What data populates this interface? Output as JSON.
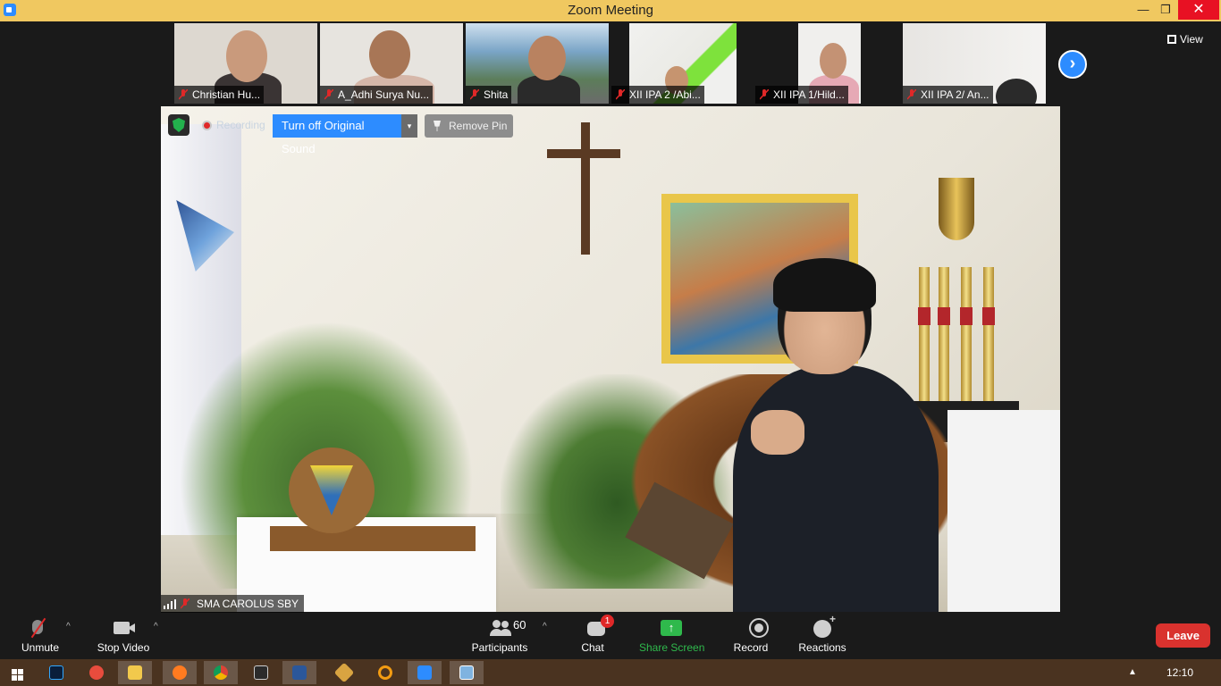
{
  "window": {
    "title": "Zoom Meeting",
    "minimize_glyph": "—",
    "maximize_glyph": "❐",
    "close_glyph": "✕"
  },
  "thumbnails": [
    {
      "name": "Christian Hu..."
    },
    {
      "name": "A_Adhi Surya Nu..."
    },
    {
      "name": "Shita"
    },
    {
      "name": "XII IPA 2 /Abi..."
    },
    {
      "name": "XII IPA 1/Hild..."
    },
    {
      "name": "XII IPA 2/ An..."
    }
  ],
  "view_label": "View",
  "next_glyph": "›",
  "overlay": {
    "recording_label": "Recording",
    "original_sound_label": "Turn off Original Sound",
    "dropdown_glyph": "▾",
    "remove_pin_label": "Remove Pin"
  },
  "main_video": {
    "participant_name": "SMA CAROLUS SBY"
  },
  "toolbar": {
    "unmute_label": "Unmute",
    "stop_video_label": "Stop Video",
    "participants_label": "Participants",
    "participants_count": "60",
    "chat_label": "Chat",
    "chat_badge": "1",
    "share_label": "Share Screen",
    "share_glyph": "↑",
    "record_label": "Record",
    "reactions_label": "Reactions",
    "leave_label": "Leave",
    "caret_glyph": "^"
  },
  "taskbar": {
    "clock": "12:10",
    "tray_glyph": "▲"
  },
  "colors": {
    "titlebar": "#f0c860",
    "accent_blue": "#2d8cff",
    "share_green": "#2fb94c",
    "leave_red": "#d9322e",
    "muted_red": "#e02828"
  }
}
